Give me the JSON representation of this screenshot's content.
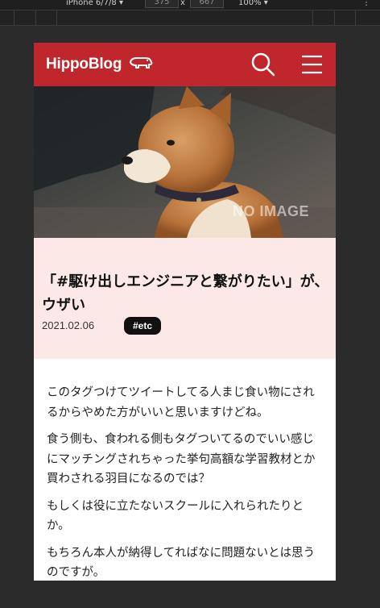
{
  "devtools": {
    "device": "iPhone 6/7/8 ▾",
    "width": "375",
    "height": "667",
    "zoom": "100% ▾",
    "menu": "⋮"
  },
  "header": {
    "logo_text": "HippoBlog",
    "bg_color": "#c0272d"
  },
  "hero": {
    "watermark": "NO IMAGE"
  },
  "post": {
    "title": "「#駆け出しエンジニアと繋がりたい」が、ウザい",
    "date": "2021.02.06",
    "tag": "#etc",
    "head_bg": "#fde8e8",
    "paragraphs": [
      "このタグつけてツイートしてる人まじ食い物にされるからやめた方がいいと思いますけどね。",
      "食う側も、食われる側もタグついてるのでいい感じにマッチングされちゃった挙句高額な学習教材とか買わされる羽目になるのでは？",
      "もしくは役に立たないスクールに入れられたりとか。",
      "もちろん本人が納得してればなに問題ないとは思うのですが。"
    ]
  }
}
